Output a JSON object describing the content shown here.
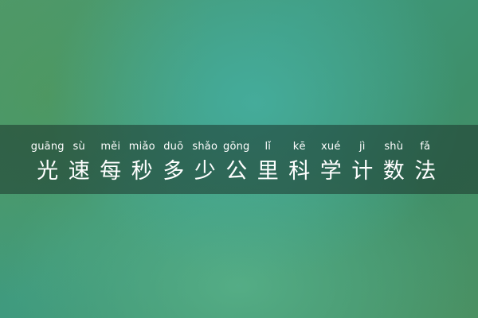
{
  "title": {
    "chars": [
      {
        "pinyin": "guāng",
        "hanzi": "光"
      },
      {
        "pinyin": "sù",
        "hanzi": "速"
      },
      {
        "pinyin": "měi",
        "hanzi": "每"
      },
      {
        "pinyin": "miǎo",
        "hanzi": "秒"
      },
      {
        "pinyin": "duō",
        "hanzi": "多"
      },
      {
        "pinyin": "shǎo",
        "hanzi": "少"
      },
      {
        "pinyin": "gōng",
        "hanzi": "公"
      },
      {
        "pinyin": "lǐ",
        "hanzi": "里"
      },
      {
        "pinyin": "kē",
        "hanzi": "科"
      },
      {
        "pinyin": "xué",
        "hanzi": "学"
      },
      {
        "pinyin": "jì",
        "hanzi": "计"
      },
      {
        "pinyin": "shù",
        "hanzi": "数"
      },
      {
        "pinyin": "fǎ",
        "hanzi": "法"
      }
    ]
  },
  "colors": {
    "text": "#ffffff",
    "band": "#1c342c",
    "background": "#3f9a7e"
  }
}
